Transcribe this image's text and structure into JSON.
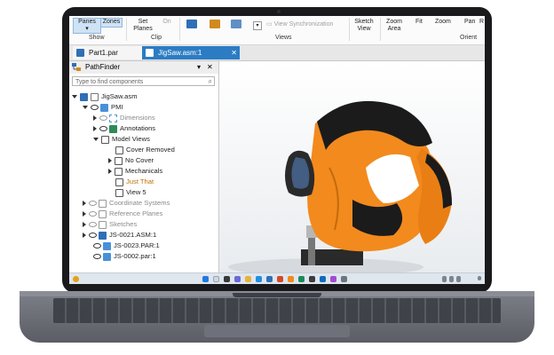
{
  "ribbon": {
    "panes": "Panes",
    "zones": "Zones",
    "show": "Show",
    "set_planes_1": "Set",
    "set_planes_2": "Planes",
    "on": "On",
    "clip": "Clip",
    "view_sync": "View Synchronization",
    "views": "Views",
    "sketch_1": "Sketch",
    "sketch_2": "View",
    "zoom_area_1": "Zoom",
    "zoom_area_2": "Area",
    "fit": "Fit",
    "zoom": "Zoom",
    "pan": "Pan",
    "r": "R",
    "orient": "Orient"
  },
  "tabs": [
    {
      "label": "Part1.par",
      "close": "✕"
    },
    {
      "label": "JigSaw.asm:1",
      "close": "✕"
    }
  ],
  "pathfinder": {
    "title": "PathFinder",
    "pin": "▾",
    "close": "✕",
    "search_placeholder": "Type to find components",
    "search_icon": "⌕",
    "items": [
      {
        "label": "JigSaw.asm"
      },
      {
        "label": "PMI"
      },
      {
        "label": "Dimensions"
      },
      {
        "label": "Annotations"
      },
      {
        "label": "Model Views"
      },
      {
        "label": "Cover Removed"
      },
      {
        "label": "No Cover"
      },
      {
        "label": "Mechanicals"
      },
      {
        "label": "Just That"
      },
      {
        "label": "View 5"
      },
      {
        "label": "Coordinate Systems"
      },
      {
        "label": "Reference Planes"
      },
      {
        "label": "Sketches"
      },
      {
        "label": "JS-0021.ASM:1"
      },
      {
        "label": "JS-0023.PAR:1"
      },
      {
        "label": "JS-0002.par:1"
      }
    ]
  },
  "colors": {
    "accent": "#2c7cc4",
    "tool_orange": "#f28a1e",
    "tool_black": "#1b1b1b",
    "selected_text": "#c07000"
  }
}
